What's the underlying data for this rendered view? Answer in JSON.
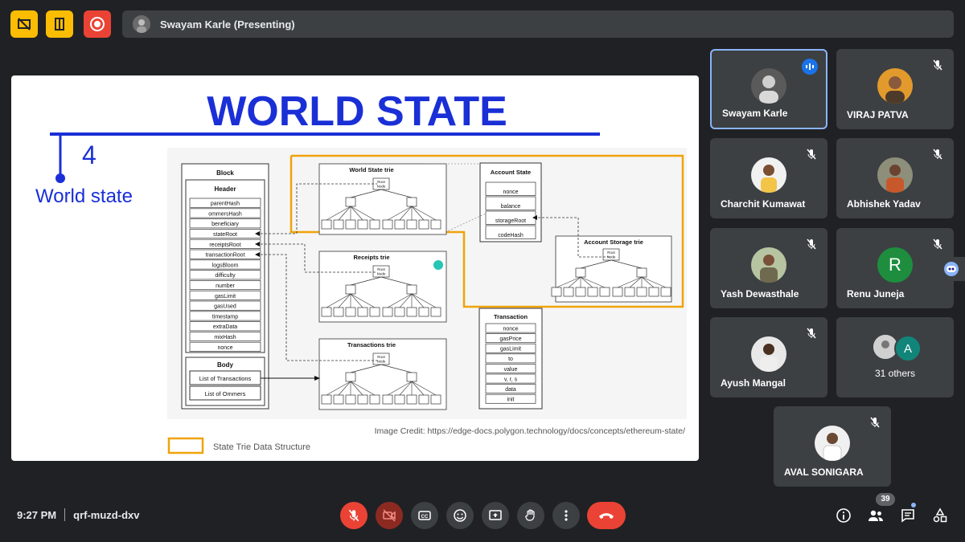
{
  "presenter_bar": {
    "label": "Swayam Karle (Presenting)"
  },
  "slide": {
    "title": "WORLD STATE",
    "number": "4",
    "subtitle": "World state",
    "credit": "Image Credit: https://edge-docs.polygon.technology/docs/concepts/ethereum-state/",
    "legend_label": "State Trie Data Structure",
    "diagram": {
      "block_title": "Block",
      "header_title": "Header",
      "header_fields": [
        "parentHash",
        "ommersHash",
        "beneficiary",
        "stateRoot",
        "receiptsRoot",
        "transactionRoot",
        "logsBloom",
        "difficulty",
        "number",
        "gasLimit",
        "gasUsed",
        "timestamp",
        "extraData",
        "mixHash",
        "nonce"
      ],
      "body_title": "Body",
      "body_fields": [
        "List of Transactions",
        "List of Ommers"
      ],
      "world_state_trie": "World State trie",
      "receipts_trie": "Receipts trie",
      "transactions_trie": "Transactions trie",
      "root_node": "Root Node",
      "account_state_title": "Account State",
      "account_state_fields": [
        "nonce",
        "balance",
        "storageRoot",
        "codeHash"
      ],
      "account_storage_trie": "Account Storage trie",
      "transaction_title": "Transaction",
      "transaction_fields": [
        "nonce",
        "gasPrice",
        "gasLimit",
        "to",
        "value",
        "v, r, s",
        "data",
        "init"
      ]
    }
  },
  "participants": [
    {
      "name": "Swayam Karle",
      "speaking": true
    },
    {
      "name": "VIRAJ PATVA"
    },
    {
      "name": "Charchit Kumawat"
    },
    {
      "name": "Abhishek Yadav"
    },
    {
      "name": "Yash Dewasthale"
    },
    {
      "name": "Renu Juneja",
      "initial": "R",
      "color": "#1e8e3e"
    },
    {
      "name": "Ayush Mangal"
    },
    {
      "others_label": "31 others",
      "initial": "A",
      "color": "#12857a"
    },
    {
      "name": "AVAL SONIGARA"
    }
  ],
  "bottom": {
    "time": "9:27 PM",
    "meeting_code": "qrf-muzd-dxv",
    "people_count": "39"
  },
  "colors": {
    "accent": "#8ab4f8",
    "danger": "#ea4335",
    "topbar_yellow": "#fbbc04",
    "title_blue": "#1a2fd6"
  }
}
